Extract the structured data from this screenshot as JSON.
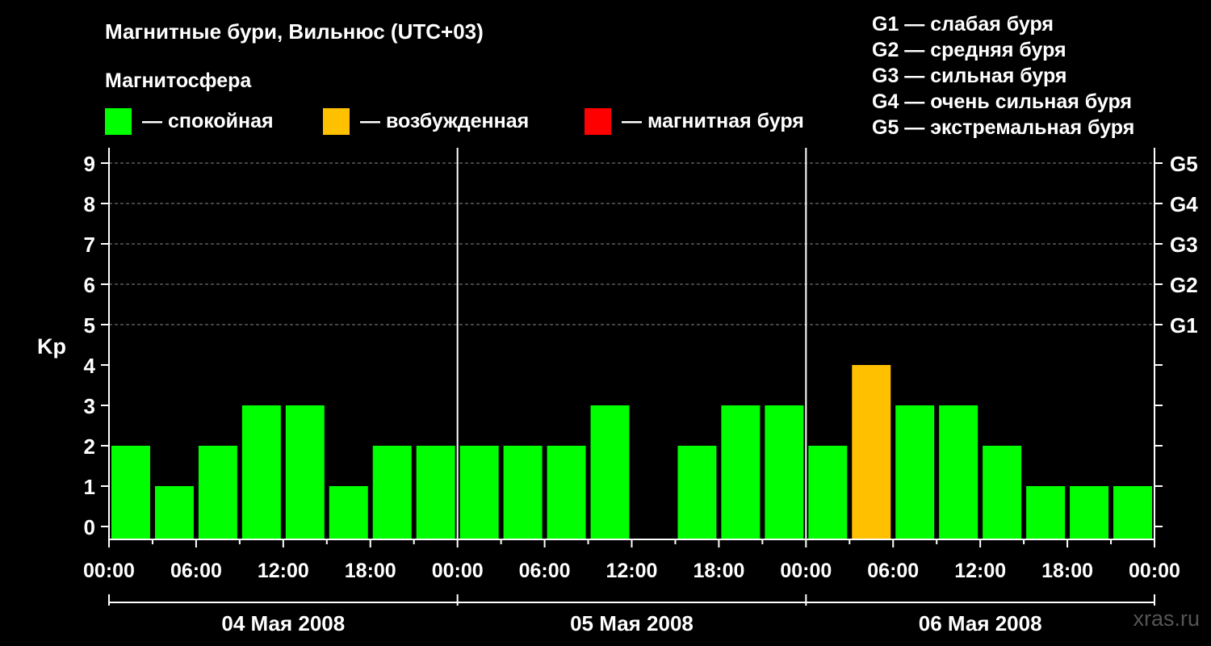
{
  "header": {
    "title": "Магнитные бури, Вильнюс (UTC+03)",
    "subtitle": "Магнитосфера"
  },
  "legend": [
    {
      "label": "— спокойная",
      "color": "#00ff00"
    },
    {
      "label": "— возбужденная",
      "color": "#ffc000"
    },
    {
      "label": "— магнитная буря",
      "color": "#ff0000"
    }
  ],
  "g_scale": [
    "G1 — слабая буря",
    "G2 — средняя буря",
    "G3 — сильная буря",
    "G4 — очень сильная буря",
    "G5 — экстремальная буря"
  ],
  "watermark": "xras.ru",
  "chart_data": {
    "type": "bar",
    "ylabel": "Kp",
    "ylim": [
      0,
      9
    ],
    "y_ticks": [
      "0",
      "1",
      "2",
      "3",
      "4",
      "5",
      "6",
      "7",
      "8",
      "9"
    ],
    "right_ticks": [
      {
        "kp": 5,
        "label": "G1"
      },
      {
        "kp": 6,
        "label": "G2"
      },
      {
        "kp": 7,
        "label": "G3"
      },
      {
        "kp": 8,
        "label": "G4"
      },
      {
        "kp": 9,
        "label": "G5"
      }
    ],
    "x_tick_labels": [
      "00:00",
      "06:00",
      "12:00",
      "18:00",
      "00:00",
      "06:00",
      "12:00",
      "18:00",
      "00:00",
      "06:00",
      "12:00",
      "18:00",
      "00:00"
    ],
    "days": [
      "04 Мая 2008",
      "05 Мая 2008",
      "06 Мая 2008"
    ],
    "interval_hours": 3,
    "values": [
      2,
      1,
      2,
      3,
      3,
      1,
      2,
      2,
      2,
      2,
      2,
      3,
      0,
      2,
      3,
      3,
      2,
      4,
      3,
      3,
      2,
      1,
      1,
      1
    ],
    "colors": {
      "quiet": "#00ff00",
      "unsettled": "#ffc000",
      "storm": "#ff0000"
    },
    "grid": "dashed horizontal at 5–9"
  }
}
